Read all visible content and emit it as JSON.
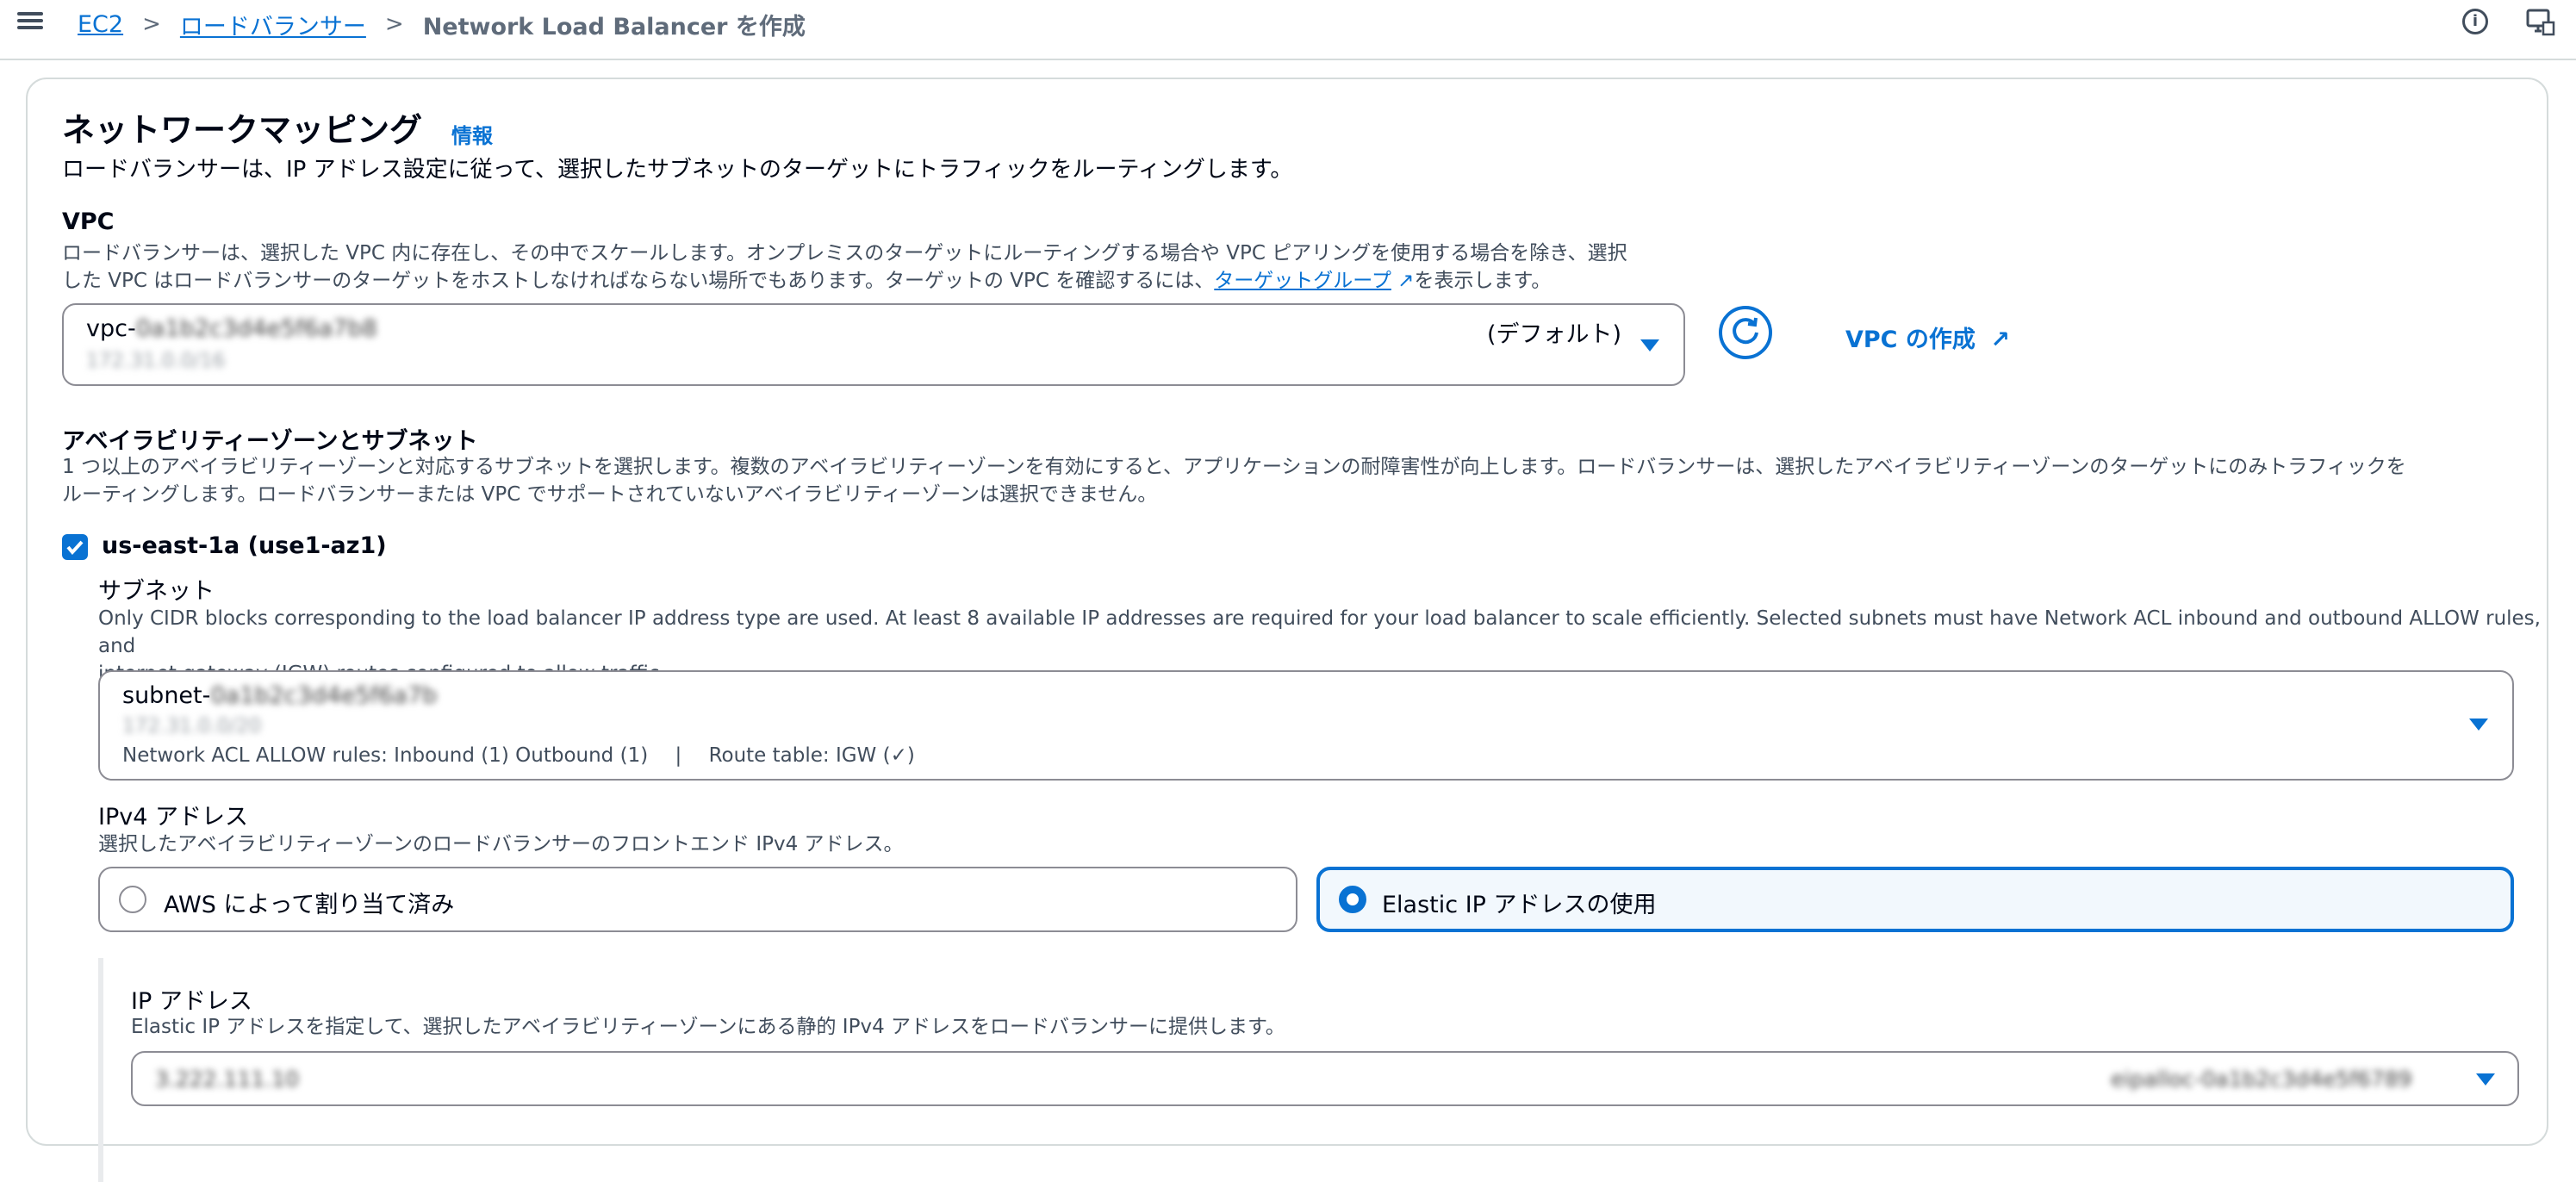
{
  "breadcrumb": {
    "items": [
      "EC2",
      "ロードバランサー"
    ],
    "current": "Network Load Balancer を作成"
  },
  "section": {
    "title": "ネットワークマッピング",
    "info": "情報",
    "description": "ロードバランサーは、IP アドレス設定に従って、選択したサブネットのターゲットにトラフィックをルーティングします。"
  },
  "vpc": {
    "label": "VPC",
    "desc_line1": "ロードバランサーは、選択した VPC 内に存在し、その中でスケールします。オンプレミスのターゲットにルーティングする場合や VPC ピアリングを使用する場合を除き、選択",
    "desc_line2_prefix": "した VPC はロードバランサーのターゲットをホストしなければならない場所でもあります。ターゲットの VPC を確認するには、",
    "desc_link": "ターゲットグループ",
    "desc_line2_suffix": "を表示します。",
    "selected_prefix": "vpc-",
    "selected_masked": "0a1b2c3d4e5f6a7b8",
    "selected_sub_masked": "172.31.0.0/16",
    "default_tag": "(デフォルト)",
    "create_label": "VPC の作成"
  },
  "az": {
    "label": "アベイラビリティーゾーンとサブネット",
    "desc_line1": "1 つ以上のアベイラビリティーゾーンと対応するサブネットを選択します。複数のアベイラビリティーゾーンを有効にすると、アプリケーションの耐障害性が向上します。ロードバランサーは、選択したアベイラビリティーゾーンのターゲットにのみトラフィックを",
    "desc_line2": "ルーティングします。ロードバランサーまたは VPC でサポートされていないアベイラビリティーゾーンは選択できません。",
    "zone_label": "us-east-1a (use1-az1)"
  },
  "subnet": {
    "label": "サブネット",
    "desc_line1": "Only CIDR blocks corresponding to the load balancer IP address type are used. At least 8 available IP addresses are required for your load balancer to scale efficiently. Selected subnets must have Network ACL inbound and outbound ALLOW rules, and",
    "desc_line2": "internet gateway (IGW) routes configured to allow traffic.",
    "selected_prefix": "subnet-",
    "selected_masked": "0a1b2c3d4e5f6a7b",
    "selected_sub_masked": "172.31.0.0/20",
    "acl_info": "Network ACL ALLOW rules: Inbound (1) Outbound (1)",
    "separator": "|",
    "route_info": "Route table: IGW (✓)"
  },
  "ipv4": {
    "label": "IPv4 アドレス",
    "desc": "選択したアベイラビリティーゾーンのロードバランサーのフロントエンド IPv4 アドレス。",
    "option_aws": "AWS によって割り当て済み",
    "option_eip": "Elastic IP アドレスの使用"
  },
  "ipaddr": {
    "label": "IP アドレス",
    "desc": "Elastic IP アドレスを指定して、選択したアベイラビリティーゾーンにある静的 IPv4 アドレスをロードバランサーに提供します。",
    "selected_masked": "3.222.111.10",
    "alloc_masked": "eipalloc-0a1b2c3d4e5f6789"
  },
  "colors": {
    "accent": "#0972d3",
    "border": "#8c8c94",
    "text_secondary": "#414d5c"
  }
}
